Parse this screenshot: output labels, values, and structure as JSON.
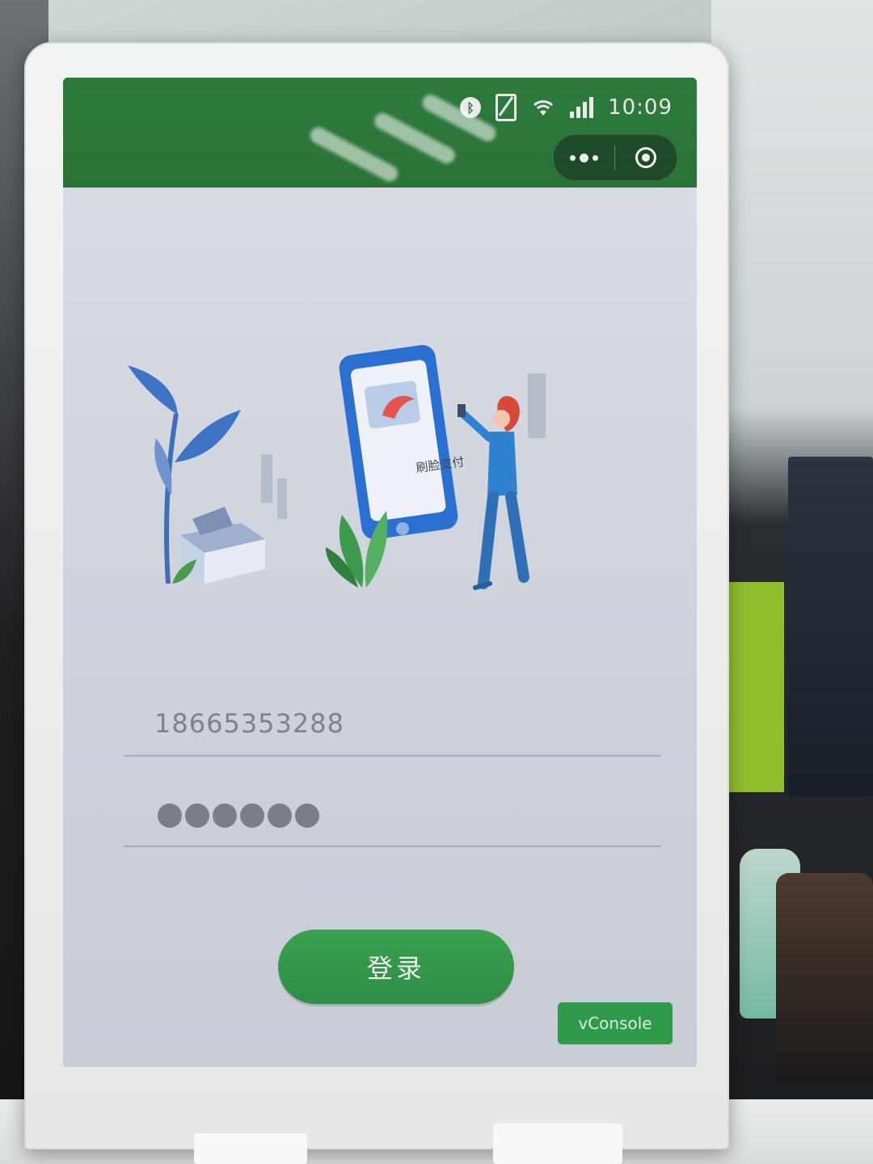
{
  "status_bar": {
    "time": "10:09",
    "icons": [
      "bluetooth-icon",
      "no-sim-icon",
      "wifi-icon",
      "signal-icon"
    ]
  },
  "mini_program_capsule": {
    "more_icon": "more-dots-icon",
    "close_icon": "target-close-icon"
  },
  "illustration": {
    "caption": "刷脸支付"
  },
  "login_form": {
    "phone_value": "18665353288",
    "password_mask_count": 6,
    "submit_label": "登录"
  },
  "debug": {
    "vconsole_label": "vConsole"
  },
  "colors": {
    "header_green": "#2e7a3d",
    "button_green": "#2f8d45",
    "content_bg": "#d3d7df"
  }
}
